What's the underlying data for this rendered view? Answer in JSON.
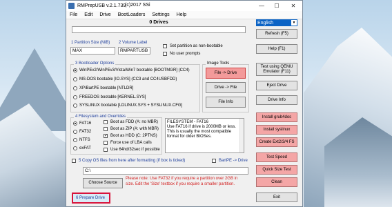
{
  "window": {
    "title": "RMPrepUSB v.2.1.739",
    "copyright": "(c)2017 SSi",
    "controls": {
      "minimize": "—",
      "maximize": "☐",
      "close": "✕"
    }
  },
  "menu": [
    "File",
    "Edit",
    "Drive",
    "BootLoaders",
    "Settings",
    "Help"
  ],
  "drives": {
    "label": "0 Drives"
  },
  "partition": {
    "size_label": "1 Partition Size (MiB)",
    "size_value": "MAX",
    "volume_label": "2 Volume Label",
    "volume_value": "RMPARTUSB",
    "non_bootable": "Set partition as non-bootable",
    "no_prompts": "No user prompts"
  },
  "bootloader": {
    "title": "3 Bootloader Options",
    "options": [
      "WinPEv2/WinPEv3/Vista/Win7 bootable [BOOTMGR] (CC4)",
      "MS-DOS bootable [IO.SYS]     (CC3 and CC4USBFDD)",
      "XP/BartPE bootable [NTLDR]",
      "FREEDOS bootable [KERNEL.SYS]",
      "SYSLINUX bootable [LDLINUX.SYS + SYSLINUX.CFG]"
    ],
    "selected": 0
  },
  "image_tools": {
    "title": "Image Tools",
    "file_to_drive": "File -> Drive",
    "drive_to_file": "Drive -> File",
    "file_info": "File Info"
  },
  "filesystem": {
    "title": "4 Filesystem and Overrides",
    "options": [
      "FAT16",
      "FAT32",
      "NTFS",
      "exFAT"
    ],
    "selected": 0,
    "overrides": [
      "Boot as FDD (A: no MBR)",
      "Boot as ZIP (A: with MBR)",
      "Boot as HDD (C: 2PTNS)",
      "Force use of LBA calls",
      "Use 64hd/32sec if possible"
    ],
    "info_text": "FILESYSTEM - FAT16\nUse FAT16 if drive is 2000MB or less.\nThis is usually the most compatible\nformat for older BIOSes."
  },
  "copy_os": {
    "label": "5 Copy OS files from here after formatting (if box is ticked)",
    "bartpe": "BartPE -> Drive",
    "path_value": "C:\\",
    "choose_source": "Choose Source",
    "note": "Please note: Use FAT32 if you require a partition over 2GB in size. Edit the 'Size' textbox if you require a smaller partition."
  },
  "prepare": {
    "label": "6 Prepare Drive"
  },
  "right_panel": {
    "language": "English",
    "refresh": "Refresh (F5)",
    "help": "Help (F1)",
    "test_qemu": "Test using QEMU Emulator (F11)",
    "eject": "Eject Drive",
    "drive_info": "Drive Info",
    "install_grub4dos": "Install grub4dos",
    "install_syslinux": "Install syslinux",
    "create_ext": "Create Ext2/3/4 FS",
    "test_speed": "Test Speed",
    "quick_size_test": "Quick Size Test",
    "clean": "Clean",
    "exit": "Exit"
  },
  "colors": {
    "accent_blue": "#1f3f9c",
    "pink_button": "#f4a6a6",
    "focus_border": "#d8143c",
    "note_red": "#d21f1f"
  }
}
